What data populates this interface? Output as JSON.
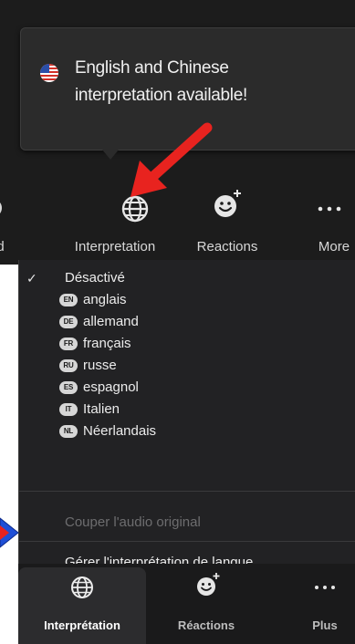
{
  "tooltip": {
    "line1": "English and Chinese",
    "line2": "interpretation available!"
  },
  "toolbar_top": {
    "left_partial_label": "rd",
    "interpretation_label": "Interpretation",
    "reactions_label": "Reactions",
    "more_label": "More"
  },
  "menu": {
    "off_label": "Désactivé",
    "languages": [
      {
        "code": "EN",
        "label": "anglais"
      },
      {
        "code": "DE",
        "label": "allemand"
      },
      {
        "code": "FR",
        "label": "français"
      },
      {
        "code": "RU",
        "label": "russe"
      },
      {
        "code": "ES",
        "label": "espagnol"
      },
      {
        "code": "IT",
        "label": "Italien"
      },
      {
        "code": "NL",
        "label": "Néerlandais"
      }
    ],
    "mute_original": "Couper l'audio original",
    "manage": "Gérer l'interprétation de langue..."
  },
  "toolbar_bottom": {
    "interpretation_label": "Interprétation",
    "reactions_label": "Réactions",
    "more_label": "Plus"
  },
  "colors": {
    "arrow_red": "#e8231f",
    "arrow_blue": "#1f4fd6",
    "background_dark": "#1c1c1c"
  }
}
